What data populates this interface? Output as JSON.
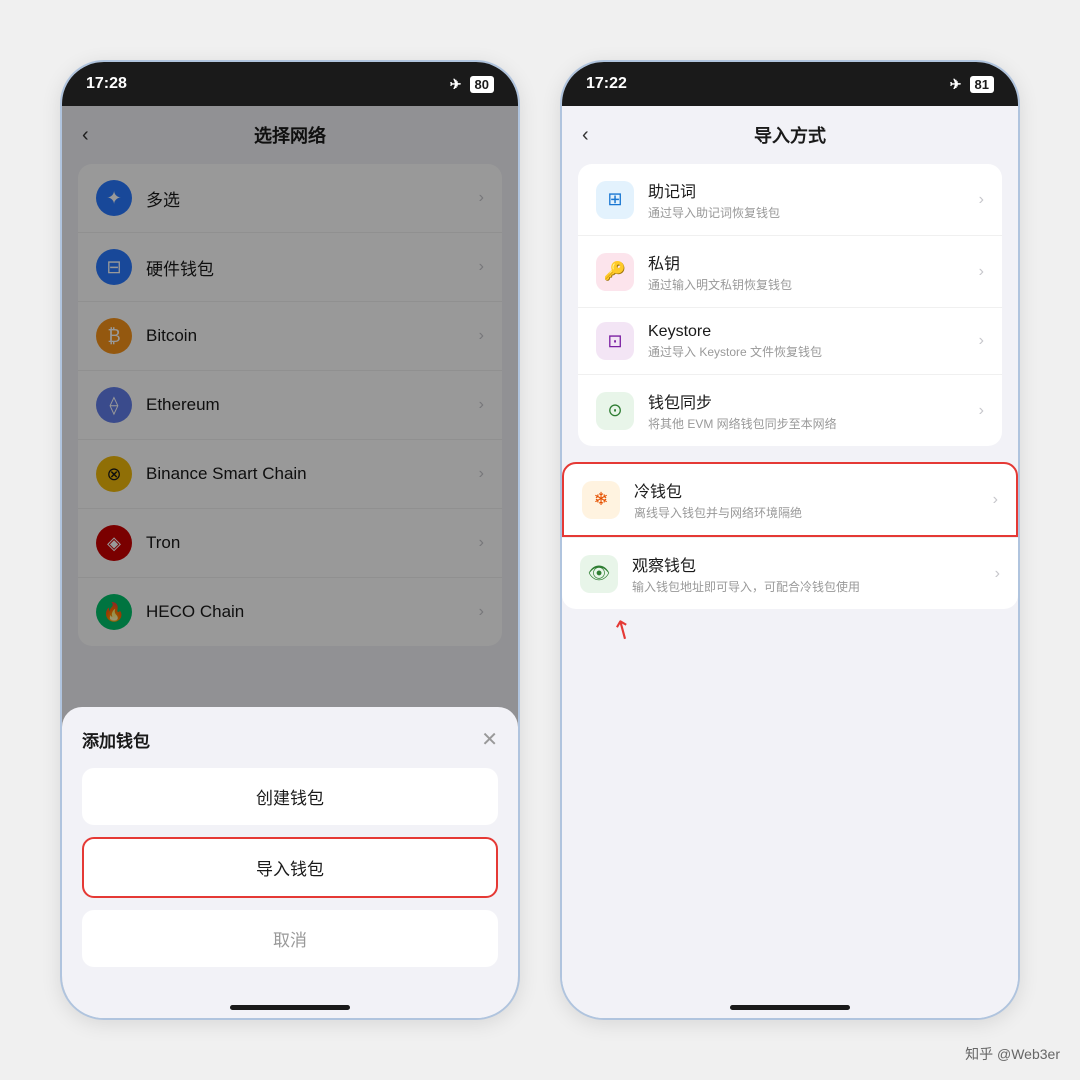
{
  "phone1": {
    "statusBar": {
      "time": "17:28",
      "battery": "80"
    },
    "header": {
      "title": "选择网络",
      "backLabel": "‹"
    },
    "networkItems": [
      {
        "id": "multiselect",
        "name": "多选",
        "iconClass": "icon-multiselect",
        "iconChar": "✦"
      },
      {
        "id": "hardware",
        "name": "硬件钱包",
        "iconClass": "icon-hardware",
        "iconChar": "⊟"
      },
      {
        "id": "bitcoin",
        "name": "Bitcoin",
        "iconClass": "icon-bitcoin",
        "iconChar": "₿"
      },
      {
        "id": "ethereum",
        "name": "Ethereum",
        "iconClass": "icon-ethereum",
        "iconChar": "⟠"
      },
      {
        "id": "binance",
        "name": "Binance Smart Chain",
        "iconClass": "icon-binance",
        "iconChar": "⊗"
      },
      {
        "id": "tron",
        "name": "Tron",
        "iconClass": "icon-tron",
        "iconChar": "◈"
      },
      {
        "id": "heco",
        "name": "HECO Chain",
        "iconClass": "icon-heco",
        "iconChar": "🔥"
      }
    ],
    "modal": {
      "title": "添加钱包",
      "closeLabel": "✕",
      "createLabel": "创建钱包",
      "importLabel": "导入钱包",
      "cancelLabel": "取消"
    }
  },
  "phone2": {
    "statusBar": {
      "time": "17:22",
      "battery": "81"
    },
    "header": {
      "title": "导入方式",
      "backLabel": "‹"
    },
    "importMethods": [
      {
        "id": "mnemonic",
        "name": "助记词",
        "desc": "通过导入助记词恢复钱包",
        "iconClass": "icon-mnemonic",
        "iconChar": "⊞"
      },
      {
        "id": "private-key",
        "name": "私钥",
        "desc": "通过输入明文私钥恢复钱包",
        "iconClass": "icon-private",
        "iconChar": "🔑"
      },
      {
        "id": "keystore",
        "name": "Keystore",
        "desc": "通过导入 Keystore 文件恢复钱包",
        "iconClass": "icon-keystore",
        "iconChar": "⊡"
      },
      {
        "id": "sync",
        "name": "钱包同步",
        "desc": "将其他 EVM 网络钱包同步至本网络",
        "iconClass": "icon-sync",
        "iconChar": "⊙"
      }
    ],
    "specialMethods": [
      {
        "id": "cold",
        "name": "冷钱包",
        "desc": "离线导入钱包并与网络环境隔绝",
        "iconClass": "icon-cold",
        "iconChar": "❄",
        "highlighted": true
      },
      {
        "id": "observe",
        "name": "观察钱包",
        "desc": "输入钱包地址即可导入，可配合冷钱包使用",
        "iconClass": "icon-observe",
        "iconChar": "👁"
      }
    ]
  },
  "watermark": "知乎 @Web3er"
}
